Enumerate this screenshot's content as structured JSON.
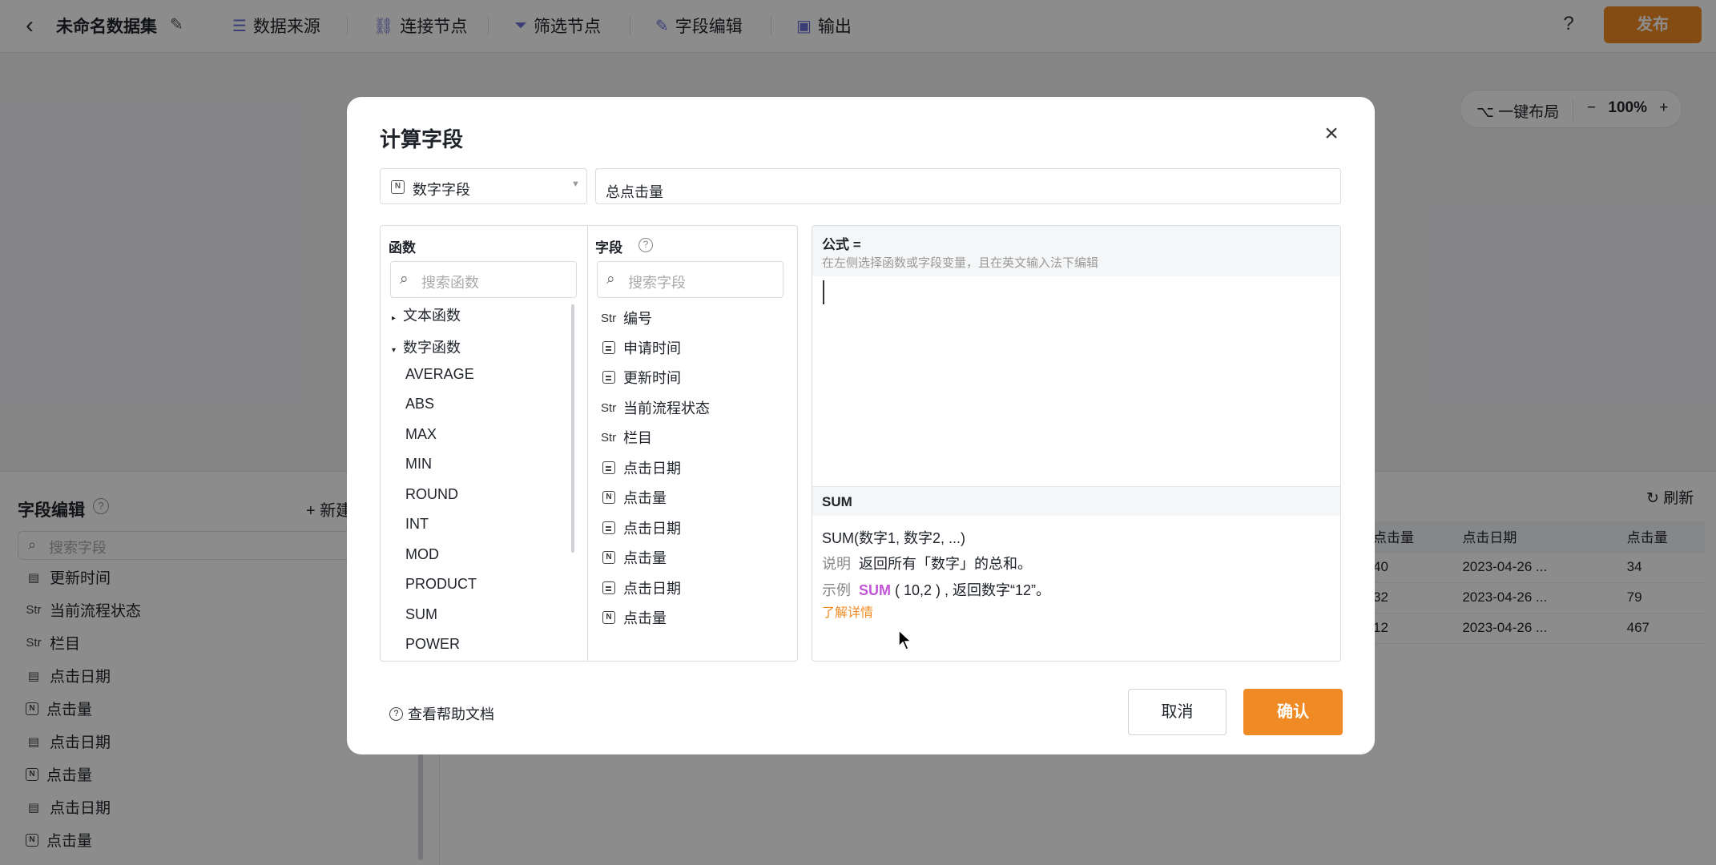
{
  "topbar": {
    "title": "未命名数据集",
    "nav": [
      {
        "label": "数据来源",
        "icon": "database-icon"
      },
      {
        "label": "连接节点",
        "icon": "link-node-icon"
      },
      {
        "label": "筛选节点",
        "icon": "filter-icon"
      },
      {
        "label": "字段编辑",
        "icon": "pencil-icon"
      },
      {
        "label": "输出",
        "icon": "output-icon"
      }
    ],
    "help": "?",
    "publish_label": "发布"
  },
  "canvas_controls": {
    "layout_label": "一键布局",
    "zoom": "100%"
  },
  "field_editor": {
    "title": "字段编辑",
    "new_label": "新建",
    "search_placeholder": "搜索字段",
    "items": [
      {
        "type": "date",
        "label": "更新时间"
      },
      {
        "type": "Str",
        "label": "当前流程状态"
      },
      {
        "type": "Str",
        "label": "栏目"
      },
      {
        "type": "date",
        "label": "点击日期"
      },
      {
        "type": "N",
        "label": "点击量"
      },
      {
        "type": "date",
        "label": "点击日期"
      },
      {
        "type": "N",
        "label": "点击量"
      },
      {
        "type": "date",
        "label": "点击日期"
      },
      {
        "type": "N",
        "label": "点击量"
      }
    ]
  },
  "preview": {
    "refresh_label": "刷新",
    "columns": [
      "点击量",
      "点击日期",
      "点击量"
    ],
    "rows": [
      [
        "40",
        "2023-04-26 ...",
        "34"
      ],
      [
        "32",
        "2023-04-26 ...",
        "79"
      ],
      [
        "12",
        "2023-04-26 ...",
        "467"
      ]
    ]
  },
  "modal": {
    "title": "计算字段",
    "field_type": "数字字段",
    "field_type_icon": "N",
    "field_name": "总点击量",
    "functions": {
      "header": "函数",
      "search_placeholder": "搜索函数",
      "groups": [
        {
          "label": "文本函数",
          "expanded": false
        },
        {
          "label": "数字函数",
          "expanded": true
        }
      ],
      "items": [
        "AVERAGE",
        "ABS",
        "MAX",
        "MIN",
        "ROUND",
        "INT",
        "MOD",
        "PRODUCT",
        "SUM",
        "POWER"
      ]
    },
    "fields": {
      "header": "字段",
      "search_placeholder": "搜索字段",
      "items": [
        {
          "type": "Str",
          "label": "编号"
        },
        {
          "type": "date",
          "label": "申请时间"
        },
        {
          "type": "date",
          "label": "更新时间"
        },
        {
          "type": "Str",
          "label": "当前流程状态"
        },
        {
          "type": "Str",
          "label": "栏目"
        },
        {
          "type": "date",
          "label": "点击日期"
        },
        {
          "type": "N",
          "label": "点击量"
        },
        {
          "type": "date",
          "label": "点击日期"
        },
        {
          "type": "N",
          "label": "点击量"
        },
        {
          "type": "date",
          "label": "点击日期"
        },
        {
          "type": "N",
          "label": "点击量"
        }
      ]
    },
    "formula": {
      "header": "公式 =",
      "hint": "在左侧选择函数或字段变量，且在英文输入法下编辑",
      "value": ""
    },
    "doc": {
      "name": "SUM",
      "signature": "SUM(数字1, 数字2, ...)",
      "desc_label": "说明",
      "desc": "返回所有「数字」的总和。",
      "example_label": "示例",
      "example_keyword": "SUM",
      "example_args": " ( 10,2 ) ",
      "example_result": ", 返回数字“12”。",
      "learn_more": "了解详情"
    },
    "help_link": "查看帮助文档",
    "cancel_label": "取消",
    "confirm_label": "确认"
  }
}
